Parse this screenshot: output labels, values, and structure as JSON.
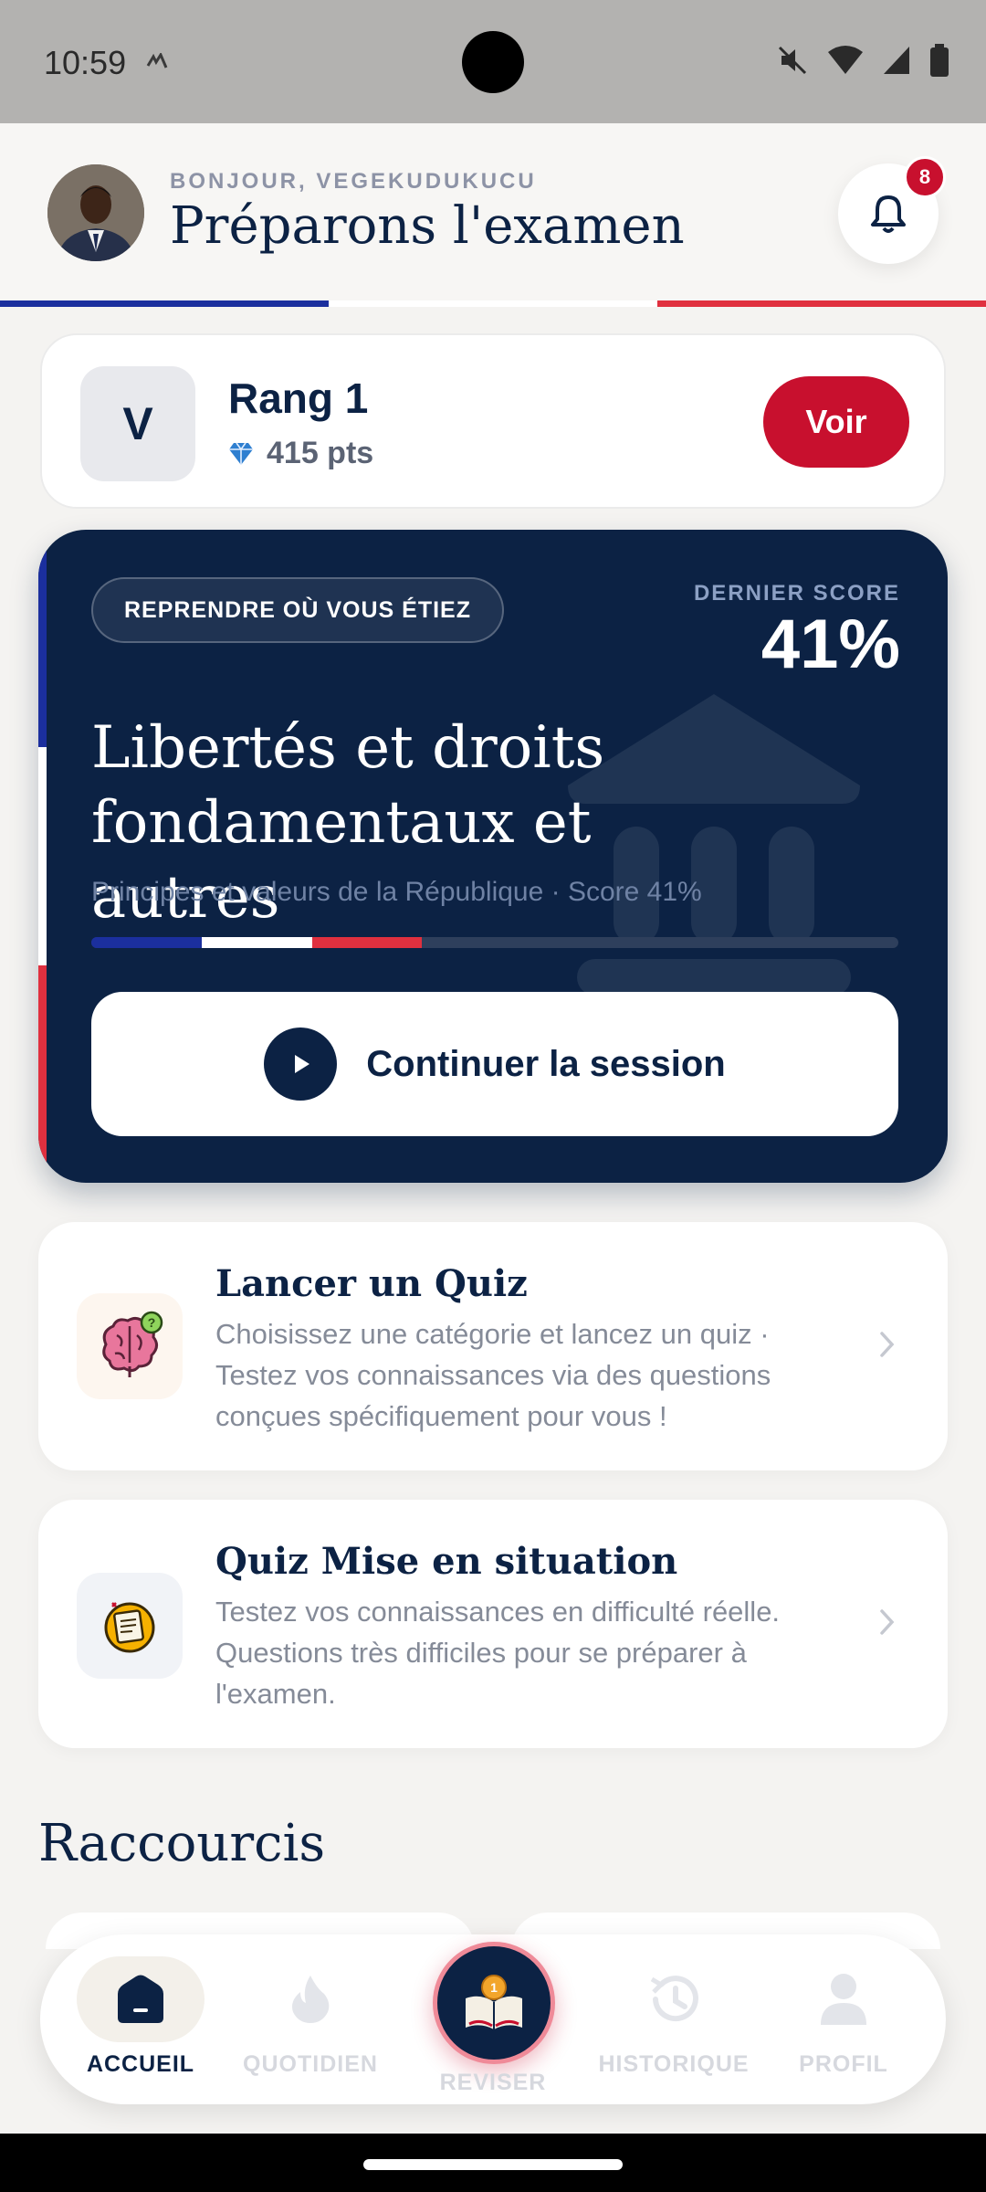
{
  "status_bar": {
    "time": "10:59"
  },
  "header": {
    "greeting": "BONJOUR, VEGEKUDUKUCU",
    "title": "Préparons l'examen",
    "notification_count": "8"
  },
  "rank_card": {
    "initial": "V",
    "rank": "Rang 1",
    "points": "415 pts",
    "action": "Voir"
  },
  "resume_card": {
    "tag": "REPRENDRE OÙ VOUS ÉTIEZ",
    "last_score_label": "DERNIER SCORE",
    "last_score_value": "41%",
    "topic": "Libertés et droits fondamentaux et autres",
    "subtitle": "Principes et valeurs de la République · Score 41%",
    "progress": 0.41,
    "continue_label": "Continuer la session"
  },
  "quiz_cards": [
    {
      "title": "Lancer un Quiz",
      "description": "Choisissez une catégorie et lancez un quiz · Testez vos connaissances via des questions conçues spécifiquement pour vous !",
      "icon": "brain-question-icon"
    },
    {
      "title": "Quiz Mise en situation",
      "description": "Testez vos connaissances en difficulté réelle. Questions très difficiles pour se préparer à l'examen.",
      "icon": "exam-paper-icon"
    }
  ],
  "shortcuts": {
    "title": "Raccourcis"
  },
  "bottom_nav": {
    "items": [
      {
        "label": "ACCUEIL",
        "icon": "home-icon",
        "active": true
      },
      {
        "label": "QUOTIDIEN",
        "icon": "flame-icon",
        "active": false
      },
      {
        "label": "REVISER",
        "icon": "book-icon",
        "active": false
      },
      {
        "label": "HISTORIQUE",
        "icon": "history-icon",
        "active": false
      },
      {
        "label": "PROFIL",
        "icon": "user-icon",
        "active": false
      }
    ]
  },
  "colors": {
    "navy": "#0c2244",
    "france_blue": "#1b2f9e",
    "france_red": "#e0303f",
    "accent_red": "#c8102e",
    "background": "#f4f3f1"
  }
}
